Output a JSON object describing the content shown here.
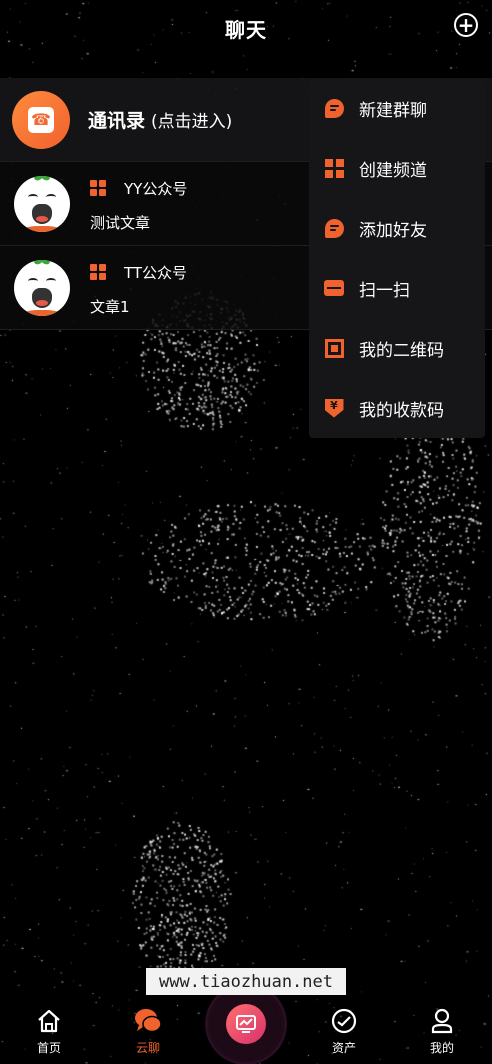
{
  "header": {
    "title": "聊天",
    "add_icon": "plus-circle-icon"
  },
  "contacts": {
    "name": "通讯录",
    "hint": "(点击进入)",
    "icon": "phone-book-icon",
    "accent": "#f0622e"
  },
  "chats": [
    {
      "name": "YY公众号",
      "preview": "测试文章",
      "badge_icon": "official-account-icon"
    },
    {
      "name": "TT公众号",
      "preview": "文章1",
      "badge_icon": "official-account-icon"
    }
  ],
  "menu": {
    "items": [
      {
        "label": "新建群聊",
        "icon": "chat-bubble-icon"
      },
      {
        "label": "创建频道",
        "icon": "grid-icon"
      },
      {
        "label": "添加好友",
        "icon": "chat-bubble-icon"
      },
      {
        "label": "扫一扫",
        "icon": "scan-icon"
      },
      {
        "label": "我的二维码",
        "icon": "qrcode-icon"
      },
      {
        "label": "我的收款码",
        "icon": "payment-code-icon"
      }
    ]
  },
  "watermark": "www.tiaozhuan.net",
  "tabbar": {
    "items": [
      {
        "label": "首页",
        "icon": "home-icon"
      },
      {
        "label": "云聊",
        "icon": "chat-icon",
        "active": true
      },
      {
        "label": "资产",
        "icon": "check-circle-icon"
      },
      {
        "label": "我的",
        "icon": "user-icon"
      }
    ],
    "center_icon": "trend-chart-icon"
  },
  "colors": {
    "accent": "#f0622e",
    "background": "#000000",
    "panel": "#161619"
  }
}
